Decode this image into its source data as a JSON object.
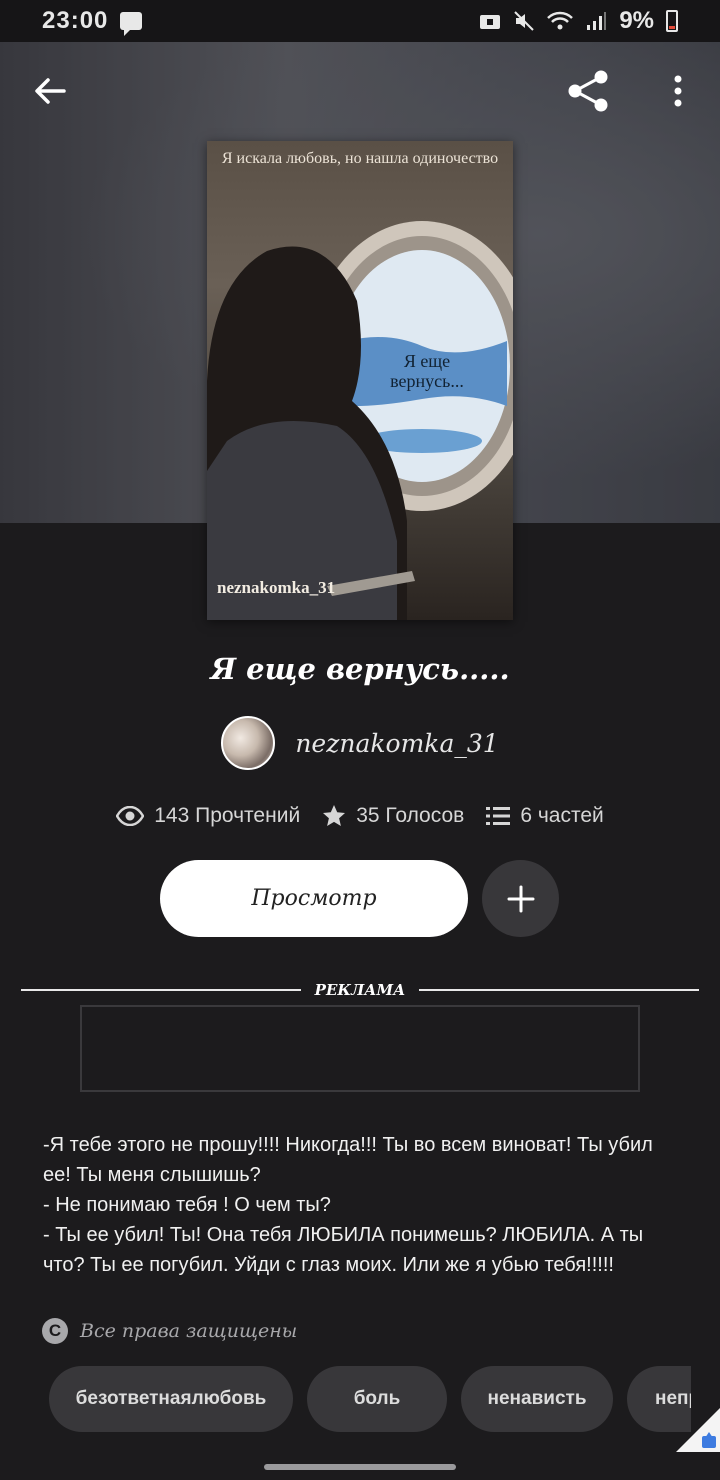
{
  "status_bar": {
    "time": "23:00",
    "battery": "9%"
  },
  "header": {
    "back_icon": "arrow-left-icon",
    "share_icon": "share-icon",
    "more_icon": "more-vertical-icon"
  },
  "cover": {
    "top_text": "Я искала любовь, но нашла одиночество",
    "window_text": "Я еще вернусь...",
    "author_text": "neznakomka_31"
  },
  "story": {
    "title": "Я еще вернусь.....",
    "author": "neznakomka_31"
  },
  "stats": {
    "reads": "143 Прочтений",
    "votes": "35 Голосов",
    "parts": "6 частей"
  },
  "actions": {
    "view_label": "Просмотр",
    "add_icon": "plus-icon"
  },
  "ad": {
    "label": "РЕКЛАМА"
  },
  "excerpt": [
    "-Я тебе этого не прошу!!!! Никогда!!! Ты во всем виноват! Ты убил ее! Ты меня слышишь?",
    "- Не понимаю тебя ! О чем ты?",
    "- Ты ее убил! Ты! Она тебя ЛЮБИЛА понимешь? ЛЮБИЛА. А ты что? Ты ее погубил. Уйди с глаз моих. Или же я убью тебя!!!!!"
  ],
  "copyright": {
    "icon": "copyright-icon",
    "text": "Все права защищены"
  },
  "tags": [
    "безответнаялюбовь",
    "боль",
    "ненависть",
    "непр"
  ],
  "colors": {
    "background": "#1c1b1d",
    "chip": "#38373a",
    "button": "#ffffff"
  }
}
